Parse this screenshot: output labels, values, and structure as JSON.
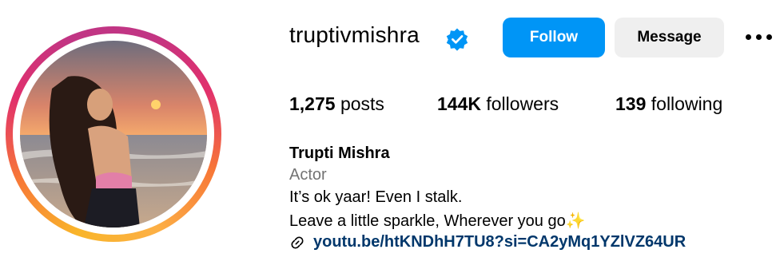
{
  "profile": {
    "username": "truptivmishra",
    "verified_icon": "verified-badge-icon",
    "full_name": "Trupti Mishra",
    "category": "Actor",
    "bio_line1": "It’s ok yaar! Even I stalk.",
    "bio_line2": "Leave a little sparkle, Wherever you go",
    "bio_emoji": "✨",
    "link": "youtu.be/htKNDhH7TU8?si=CA2yMq1YZlVZ64UR"
  },
  "actions": {
    "follow_label": "Follow",
    "message_label": "Message",
    "more_icon": "more-options-icon"
  },
  "stats": {
    "posts_count": "1,275",
    "posts_label": "posts",
    "followers_count": "144K",
    "followers_label": "followers",
    "following_count": "139",
    "following_label": "following"
  },
  "colors": {
    "follow_button": "#0095f6",
    "message_button": "#efefef",
    "link": "#00376b",
    "verified": "#0095f6",
    "category_text": "#737373"
  }
}
